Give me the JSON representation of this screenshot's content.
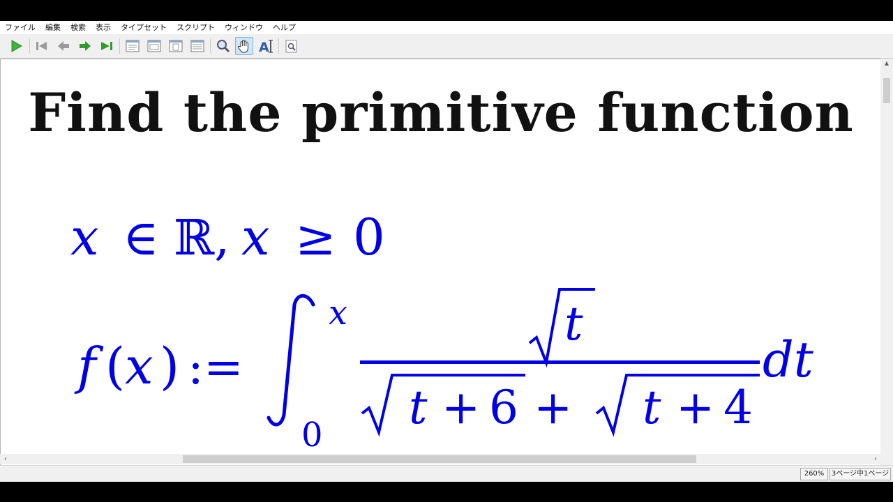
{
  "menu": [
    "ファイル",
    "編集",
    "検索",
    "表示",
    "タイプセット",
    "スクリプト",
    "ウィンドウ",
    "ヘルプ"
  ],
  "icons": {
    "typeset": "play-icon",
    "first_page": "first-page-icon",
    "prev_page": "previous-page-icon",
    "next_page": "next-page-icon",
    "last_page": "last-page-icon",
    "view_a": "page-view-icon",
    "view_b": "page-view-icon",
    "view_c": "page-view-icon",
    "view_d": "page-view-icon",
    "magnify": "magnifier-icon",
    "hand": "hand-tool-icon",
    "select_text": "text-select-icon",
    "find": "find-icon"
  },
  "colors": {
    "math": "#0000e6",
    "title": "#111111",
    "typeset_green": "#3db33d",
    "nav_green": "#2e9b2e"
  },
  "document": {
    "title": "Find the primitive function",
    "domain": {
      "var1": "x",
      "in": "∈",
      "reals": "ℝ,",
      "var2": "x",
      "geq": "≥",
      "zero": "0"
    },
    "integral": {
      "f": "f",
      "lparen": "(",
      "x": "x",
      "rparen": ")",
      "assign": ":=",
      "upper": "x",
      "lower": "0",
      "num_t": "t",
      "den_t1": "t",
      "plus1": "+",
      "six": "6",
      "plus_mid": "+",
      "den_t2": "t",
      "plus2": "+",
      "four": "4",
      "dt": "dt"
    }
  },
  "status": {
    "zoom": "260%",
    "page": "3ページ中1ページ"
  }
}
